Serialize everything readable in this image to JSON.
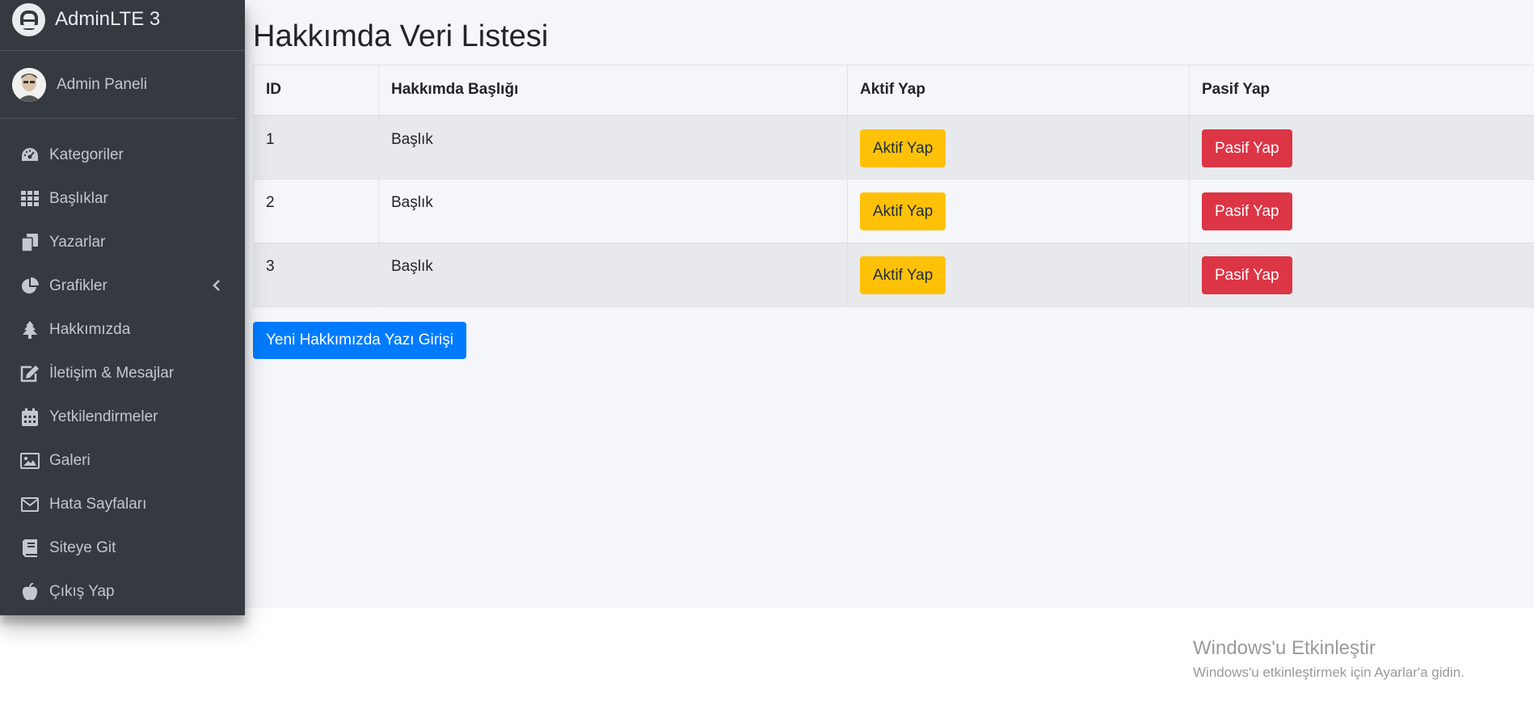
{
  "brand": {
    "name": "AdminLTE 3"
  },
  "user": {
    "name": "Admin Paneli"
  },
  "sidebar": {
    "items": [
      {
        "label": "Kategoriler",
        "icon": "tachometer-icon"
      },
      {
        "label": "Başlıklar",
        "icon": "grid-icon"
      },
      {
        "label": "Yazarlar",
        "icon": "copy-icon"
      },
      {
        "label": "Grafikler",
        "icon": "pie-chart-icon"
      },
      {
        "label": "Hakkımızda",
        "icon": "tree-icon"
      },
      {
        "label": "İletişim & Mesajlar",
        "icon": "edit-icon"
      },
      {
        "label": "Yetkilendirmeler",
        "icon": "calendar-icon"
      },
      {
        "label": "Galeri",
        "icon": "image-icon"
      },
      {
        "label": "Hata Sayfaları",
        "icon": "envelope-icon"
      },
      {
        "label": "Siteye Git",
        "icon": "book-icon"
      },
      {
        "label": "Çıkış Yap",
        "icon": "apple-icon"
      }
    ]
  },
  "page": {
    "title": "Hakkımda Veri Listesi",
    "new_button": "Yeni Hakkımızda Yazı Girişi"
  },
  "table": {
    "headers": [
      "ID",
      "Hakkımda Başlığı",
      "Aktif Yap",
      "Pasif Yap"
    ],
    "rows": [
      {
        "id": "1",
        "title": "Başlık",
        "active": "Aktif Yap",
        "passive": "Pasif Yap"
      },
      {
        "id": "2",
        "title": "Başlık",
        "active": "Aktif Yap",
        "passive": "Pasif Yap"
      },
      {
        "id": "3",
        "title": "Başlık",
        "active": "Aktif Yap",
        "passive": "Pasif Yap"
      }
    ]
  },
  "watermark": {
    "title": "Windows'u Etkinleştir",
    "subtitle": "Windows'u etkinleştirmek için Ayarlar'a gidin."
  },
  "colors": {
    "sidebar": "#343a40",
    "warning": "#ffc107",
    "danger": "#dc3545",
    "primary": "#007bff"
  }
}
